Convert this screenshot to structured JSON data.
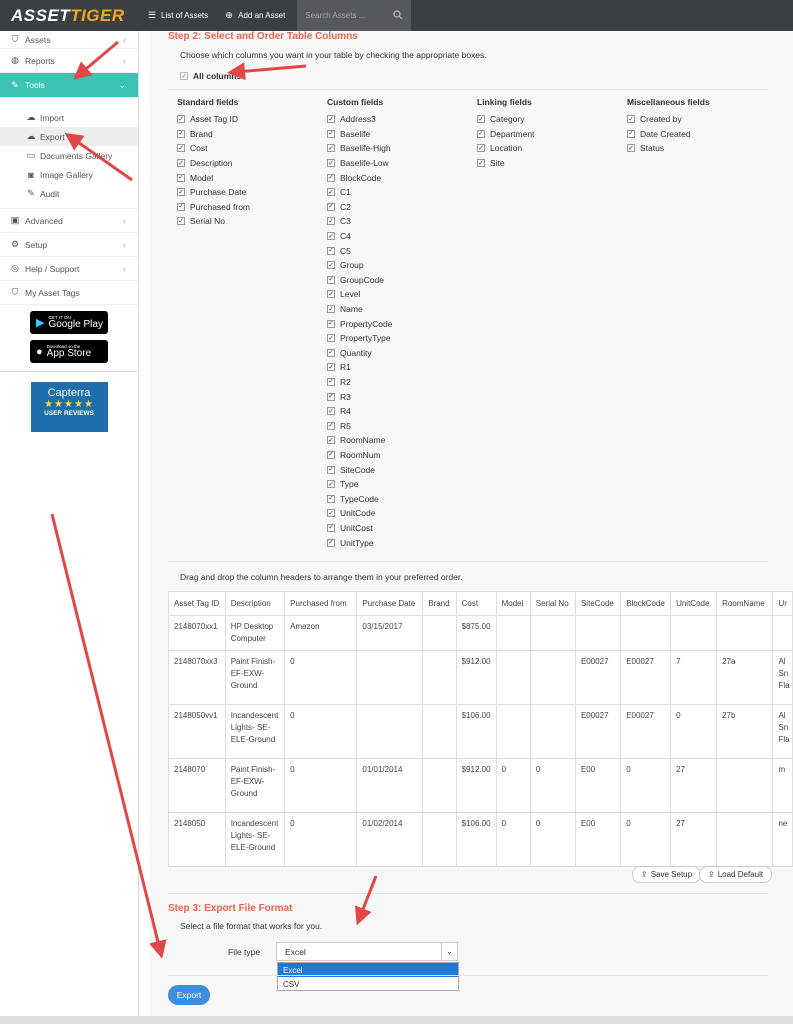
{
  "topbar": {
    "logo_a": "ASSET",
    "logo_b": "TIGER",
    "list_assets": "List of Assets",
    "add_asset": "Add an Asset",
    "search_placeholder": "Search Assets ..."
  },
  "sidebar": {
    "items_top": [
      {
        "label": "Assets",
        "icon": "tag-icon"
      },
      {
        "label": "Reports",
        "icon": "reports-icon"
      }
    ],
    "tools_label": "Tools",
    "tools_sub": [
      "Import",
      "Export",
      "Documents Gallery",
      "Image Gallery",
      "Audit"
    ],
    "items_bottom": [
      {
        "label": "Advanced",
        "icon": "advanced-icon"
      },
      {
        "label": "Setup",
        "icon": "gear-icon"
      },
      {
        "label": "Help / Support",
        "icon": "help-icon"
      },
      {
        "label": "My Asset Tags",
        "icon": "tags-icon"
      }
    ],
    "google_small": "GET IT ON",
    "google_big": "Google Play",
    "apple_small": "Download on the",
    "apple_big": "App Store",
    "capterra_name": "Capterra",
    "capterra_stars": "★★★★★",
    "capterra_reviews": "USER REVIEWS"
  },
  "step2": {
    "title": "Step 2: Select and Order Table Columns",
    "instructions": "Choose which columns you want in your table by checking the appropriate boxes.",
    "all_columns": "All columns",
    "standard_heading": "Standard fields",
    "standard": [
      "Asset Tag ID",
      "Brand",
      "Cost",
      "Description",
      "Model",
      "Purchase Date",
      "Purchased from",
      "Serial No"
    ],
    "custom_heading": "Custom fields",
    "custom": [
      "Address3",
      "Baselife",
      "Baselife-High",
      "Baselife-Low",
      "BlockCode",
      "C1",
      "C2",
      "C3",
      "C4",
      "C5",
      "Group",
      "GroupCode",
      "Level",
      "Name",
      "PropertyCode",
      "PropertyType",
      "Quantity",
      "R1",
      "R2",
      "R3",
      "R4",
      "R5",
      "RoomName",
      "RoomNum",
      "SiteCode",
      "Type",
      "TypeCode",
      "UnitCode",
      "UnitCost",
      "UnitType"
    ],
    "linking_heading": "Linking fields",
    "linking": [
      "Category",
      "Department",
      "Location",
      "Site"
    ],
    "misc_heading": "Miscellaneous fields",
    "misc": [
      "Created by",
      "Date Created",
      "Status"
    ],
    "drag_hint": "Drag and drop the column headers to arrange them in your preferred order."
  },
  "table": {
    "headers": [
      "Asset Tag ID",
      "Description",
      "Purchased from",
      "Purchase Date",
      "Brand",
      "Cost",
      "Model",
      "Serial No",
      "SiteCode",
      "BlockCode",
      "UnitCode",
      "RoomName",
      "Ur"
    ],
    "rows": [
      [
        "2148070xx1",
        "HP Desktop Computer",
        "Amazon",
        "03/15/2017",
        "",
        "$875.00",
        "",
        "",
        "",
        "",
        "",
        "",
        ""
      ],
      [
        "2148070xx3",
        "Paint Finish- EF-EXW- Ground",
        "0",
        "",
        "",
        "$912.00",
        "",
        "",
        "E00027",
        "E00027",
        "7",
        "27a",
        "Al Sn Fla"
      ],
      [
        "2148050vv1",
        "Incandescent Lights- SE- ELE-Ground",
        "0",
        "",
        "",
        "$106.00",
        "",
        "",
        "E00027",
        "E00027",
        "0",
        "27b",
        "Al Sn Fla"
      ],
      [
        "2148070",
        "Paint Finish- EF-EXW- Ground",
        "0",
        "01/01/2014",
        "",
        "$912.00",
        "0",
        "0",
        "E00",
        "0",
        "27",
        "",
        "m"
      ],
      [
        "2148050",
        "Incandescent Lights- SE- ELE-Ground",
        "0",
        "01/02/2014",
        "",
        "$106.00",
        "0",
        "0",
        "E00",
        "0",
        "27",
        "",
        "ne"
      ]
    ],
    "save_setup": "Save Setup",
    "load_default": "Load Default"
  },
  "step3": {
    "title": "Step 3: Export File Format",
    "instructions": "Select a file format that works for you.",
    "file_type_label": "File type",
    "selected": "Excel",
    "options": [
      "Excel",
      "CSV"
    ],
    "export_label": "Export"
  },
  "colors": {
    "accent_teal": "#3ec3b3",
    "step_title": "#e8654f",
    "export_blue": "#3c8dde",
    "arrow_red": "#e04848"
  }
}
